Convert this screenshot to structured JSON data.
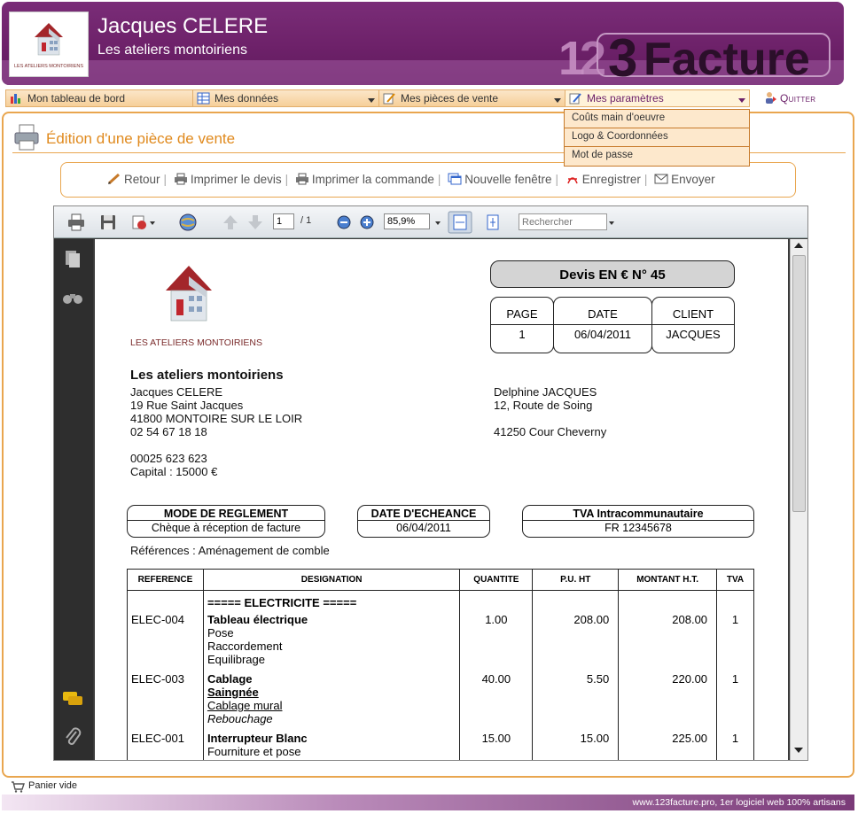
{
  "header": {
    "title": "Jacques CELERE",
    "subtitle": "Les ateliers montoiriens",
    "logo_caption": "LES ATELIERS MONTOIRIENS",
    "brand_text": "123Facture"
  },
  "nav": {
    "items": [
      {
        "label": "Mon tableau de bord",
        "icon": "chart-icon"
      },
      {
        "label": "Mes données",
        "icon": "table-icon"
      },
      {
        "label": "Mes pièces de vente",
        "icon": "edit-icon"
      },
      {
        "label": "Mes paramètres",
        "icon": "settings-pencil-icon"
      }
    ],
    "quit_label": "Quitter"
  },
  "dropdown": {
    "items": [
      "Coûts main d'oeuvre",
      "Logo & Coordonnées",
      "Mot de passe"
    ]
  },
  "page": {
    "title": "Édition d'une pièce de vente"
  },
  "toolbar": {
    "back": "Retour",
    "print_quote": "Imprimer le devis",
    "print_order": "Imprimer la commande",
    "new_window": "Nouvelle fenêtre",
    "save": "Enregistrer",
    "send": "Envoyer"
  },
  "pdf_viewer": {
    "page_current": "1",
    "page_total": "/ 1",
    "zoom": "85,9%",
    "search_placeholder": "Rechercher"
  },
  "document": {
    "logo_caption": "LES ATELIERS MONTOIRIENS",
    "heading": "Devis  EN € N° 45",
    "info_headers": [
      "PAGE",
      "DATE",
      "CLIENT"
    ],
    "info_values": [
      "1",
      "06/04/2011",
      "JACQUES"
    ],
    "company": {
      "name": "Les ateliers montoiriens",
      "contact": "Jacques CELERE",
      "address1": "19 Rue Saint Jacques",
      "address2": "41800 MONTOIRE SUR LE LOIR",
      "phone": "02 54 67 18 18",
      "siret": "00025 623 623",
      "capital": "Capital : 15000 €"
    },
    "customer": {
      "name": "Delphine JACQUES",
      "address1": "12, Route de Soing",
      "address2": "41250 Cour Cheverny"
    },
    "payment": {
      "mode_label": "MODE DE REGLEMENT",
      "mode_value": "Chèque à réception de facture",
      "due_label": "DATE D'ECHEANCE",
      "due_value": "06/04/2011",
      "vat_label": "TVA Intracommunautaire",
      "vat_value": "FR 12345678"
    },
    "references": "Références : Aménagement de comble",
    "table": {
      "headers": [
        "REFERENCE",
        "DESIGNATION",
        "QUANTITE",
        "P.U. HT",
        "MONTANT H.T.",
        "TVA"
      ],
      "section": "===== ELECTRICITE =====",
      "rows": [
        {
          "ref": "ELEC-004",
          "title": "Tableau électrique",
          "lines": [
            "Pose",
            "Raccordement",
            "Equilibrage"
          ],
          "qty": "1.00",
          "pu": "208.00",
          "total": "208.00",
          "tva": "1"
        },
        {
          "ref": "ELEC-003",
          "title": "Cablage",
          "lines": [
            "Saingnée",
            "Cablage mural",
            "Rebouchage"
          ],
          "qty": "40.00",
          "pu": "5.50",
          "total": "220.00",
          "tva": "1"
        },
        {
          "ref": "ELEC-001",
          "title": "Interrupteur Blanc",
          "lines": [
            "Fourniture et pose"
          ],
          "qty": "15.00",
          "pu": "15.00",
          "total": "225.00",
          "tva": "1"
        }
      ]
    }
  },
  "footer": {
    "cart": "Panier vide",
    "tagline": "www.123facture.pro, 1er logiciel web 100% artisans"
  },
  "colors": {
    "header_purple": "#6d2169",
    "accent_orange": "#e9a64f",
    "title_orange": "#e08a1e",
    "nav_bg": "#f6cf99"
  }
}
